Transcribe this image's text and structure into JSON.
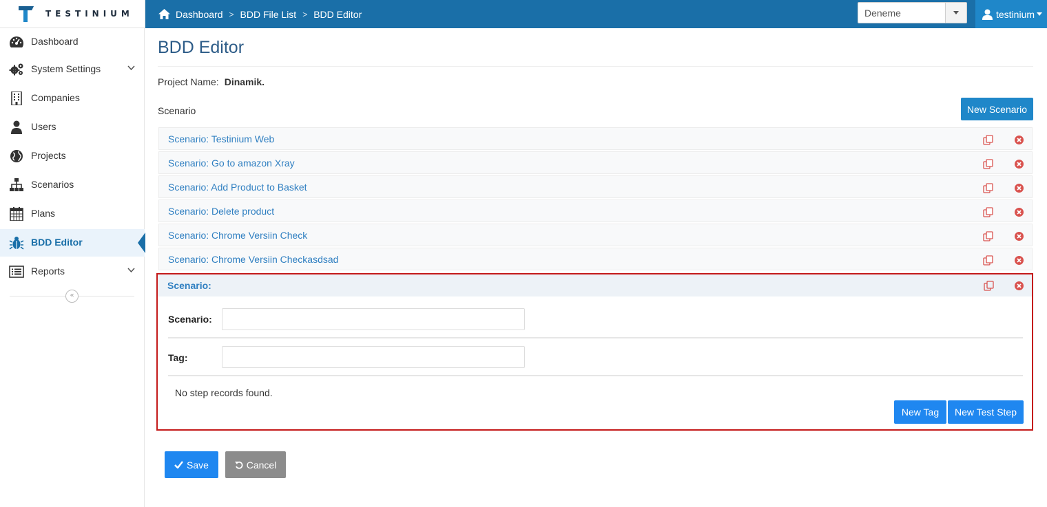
{
  "brand": {
    "name": "TESTINIUM"
  },
  "breadcrumb": {
    "items": [
      "Dashboard",
      "BDD File List",
      "BDD Editor"
    ]
  },
  "project_select": {
    "value": "Deneme"
  },
  "user": {
    "name": "testinium"
  },
  "sidebar": {
    "items": [
      {
        "label": "Dashboard",
        "icon": "dashboard-icon"
      },
      {
        "label": "System Settings",
        "icon": "gears-icon",
        "has_submenu": true
      },
      {
        "label": "Companies",
        "icon": "building-icon"
      },
      {
        "label": "Users",
        "icon": "user-icon"
      },
      {
        "label": "Projects",
        "icon": "globe-icon"
      },
      {
        "label": "Scenarios",
        "icon": "sitemap-icon"
      },
      {
        "label": "Plans",
        "icon": "calendar-icon"
      },
      {
        "label": "BDD Editor",
        "icon": "bug-icon",
        "active": true
      },
      {
        "label": "Reports",
        "icon": "list-icon",
        "has_submenu": true
      }
    ]
  },
  "page": {
    "title": "BDD Editor",
    "project_label": "Project Name:",
    "project_name": "Dinamik.",
    "scenario_label": "Scenario",
    "new_scenario_label": "New Scenario"
  },
  "scenarios": [
    "Scenario: Testinium Web",
    "Scenario: Go to amazon Xray",
    "Scenario: Add Product to Basket",
    "Scenario: Delete product",
    "Scenario: Chrome Versiin Check",
    "Scenario: Chrome Versiin Checkasdsad"
  ],
  "editor": {
    "header": "Scenario:",
    "scenario_field_label": "Scenario:",
    "scenario_value": "",
    "tag_field_label": "Tag:",
    "tag_value": "",
    "empty_steps": "No step records found.",
    "new_tag_label": "New Tag",
    "new_step_label": "New Test Step"
  },
  "actions": {
    "save_label": "Save",
    "cancel_label": "Cancel"
  },
  "colors": {
    "topbar": "#1a6fa8",
    "accent": "#1f87c9",
    "button": "#1f87f0",
    "danger": "#c41a1a",
    "link": "#2f7fc1"
  }
}
